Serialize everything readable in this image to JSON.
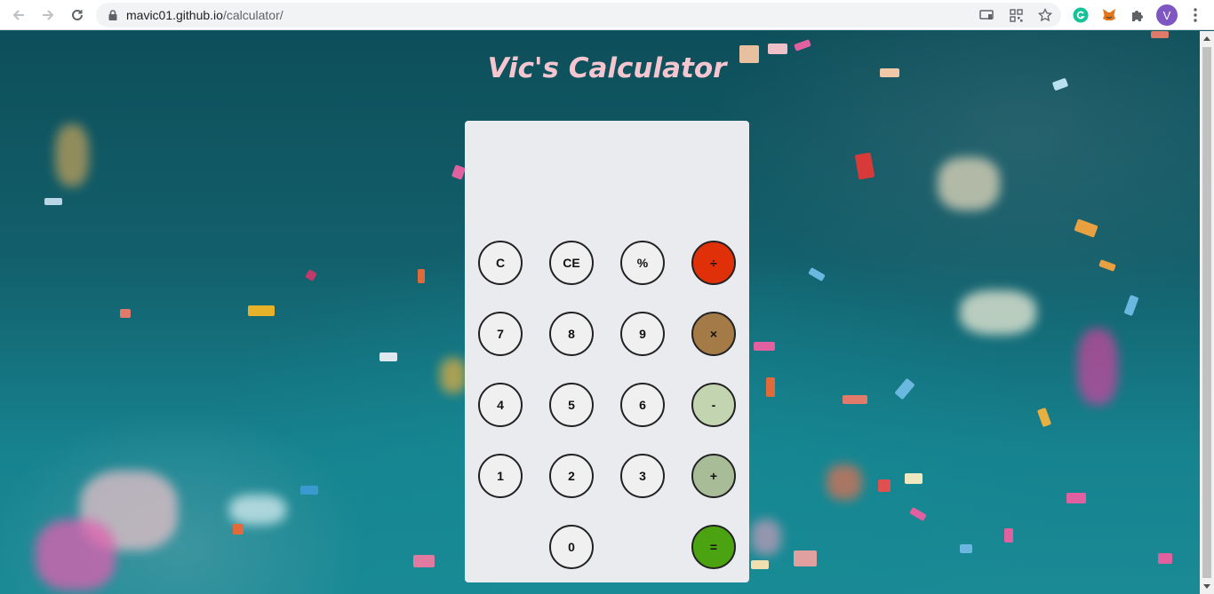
{
  "browser": {
    "url_host": "mavic01.github.io",
    "url_path": "/calculator/",
    "profile_initial": "V"
  },
  "page": {
    "title": "Vic's Calculator"
  },
  "calculator": {
    "display_value": "",
    "keys": {
      "clear": "C",
      "clear_entry": "CE",
      "percent": "%",
      "divide": "÷",
      "seven": "7",
      "eight": "8",
      "nine": "9",
      "multiply": "×",
      "four": "4",
      "five": "5",
      "six": "6",
      "subtract": "-",
      "one": "1",
      "two": "2",
      "three": "3",
      "add": "+",
      "zero": "0",
      "equals": "="
    },
    "colors": {
      "number_key": "#f0f0f0",
      "divide": "#e0300a",
      "multiply": "#a47a47",
      "subtract": "#c2d4b0",
      "add": "#a9bc98",
      "equals": "#4ba312"
    }
  },
  "icons": {
    "back": "arrow-left-icon",
    "forward": "arrow-right-icon",
    "reload": "reload-icon",
    "lock": "lock-icon",
    "cast": "cast-icon",
    "qr": "qr-code-icon",
    "bookmark": "star-icon",
    "grammarly": "grammarly-icon",
    "metamask": "metamask-icon",
    "extensions": "puzzle-icon",
    "menu": "kebab-menu-icon"
  }
}
